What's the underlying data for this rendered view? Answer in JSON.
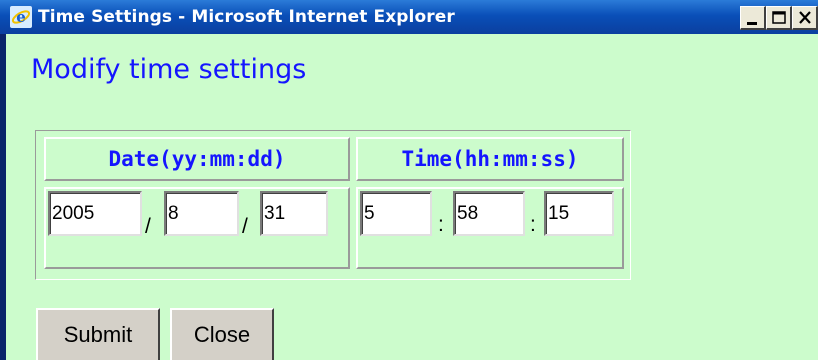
{
  "window": {
    "title": "Time Settings - Microsoft Internet Explorer",
    "icon": "ie-icon"
  },
  "page": {
    "heading": "Modify time settings"
  },
  "table": {
    "date_header": "Date(yy:mm:dd)",
    "time_header": "Time(hh:mm:ss)",
    "date": {
      "year": "2005",
      "month": "8",
      "day": "31",
      "separator": "/"
    },
    "time": {
      "hour": "5",
      "minute": "58",
      "second": "15",
      "separator": ":"
    }
  },
  "buttons": {
    "submit": "Submit",
    "close": "Close"
  },
  "colors": {
    "background": "#ccfccc",
    "heading": "#1515ff",
    "titlebar": "#0a4fb8"
  }
}
